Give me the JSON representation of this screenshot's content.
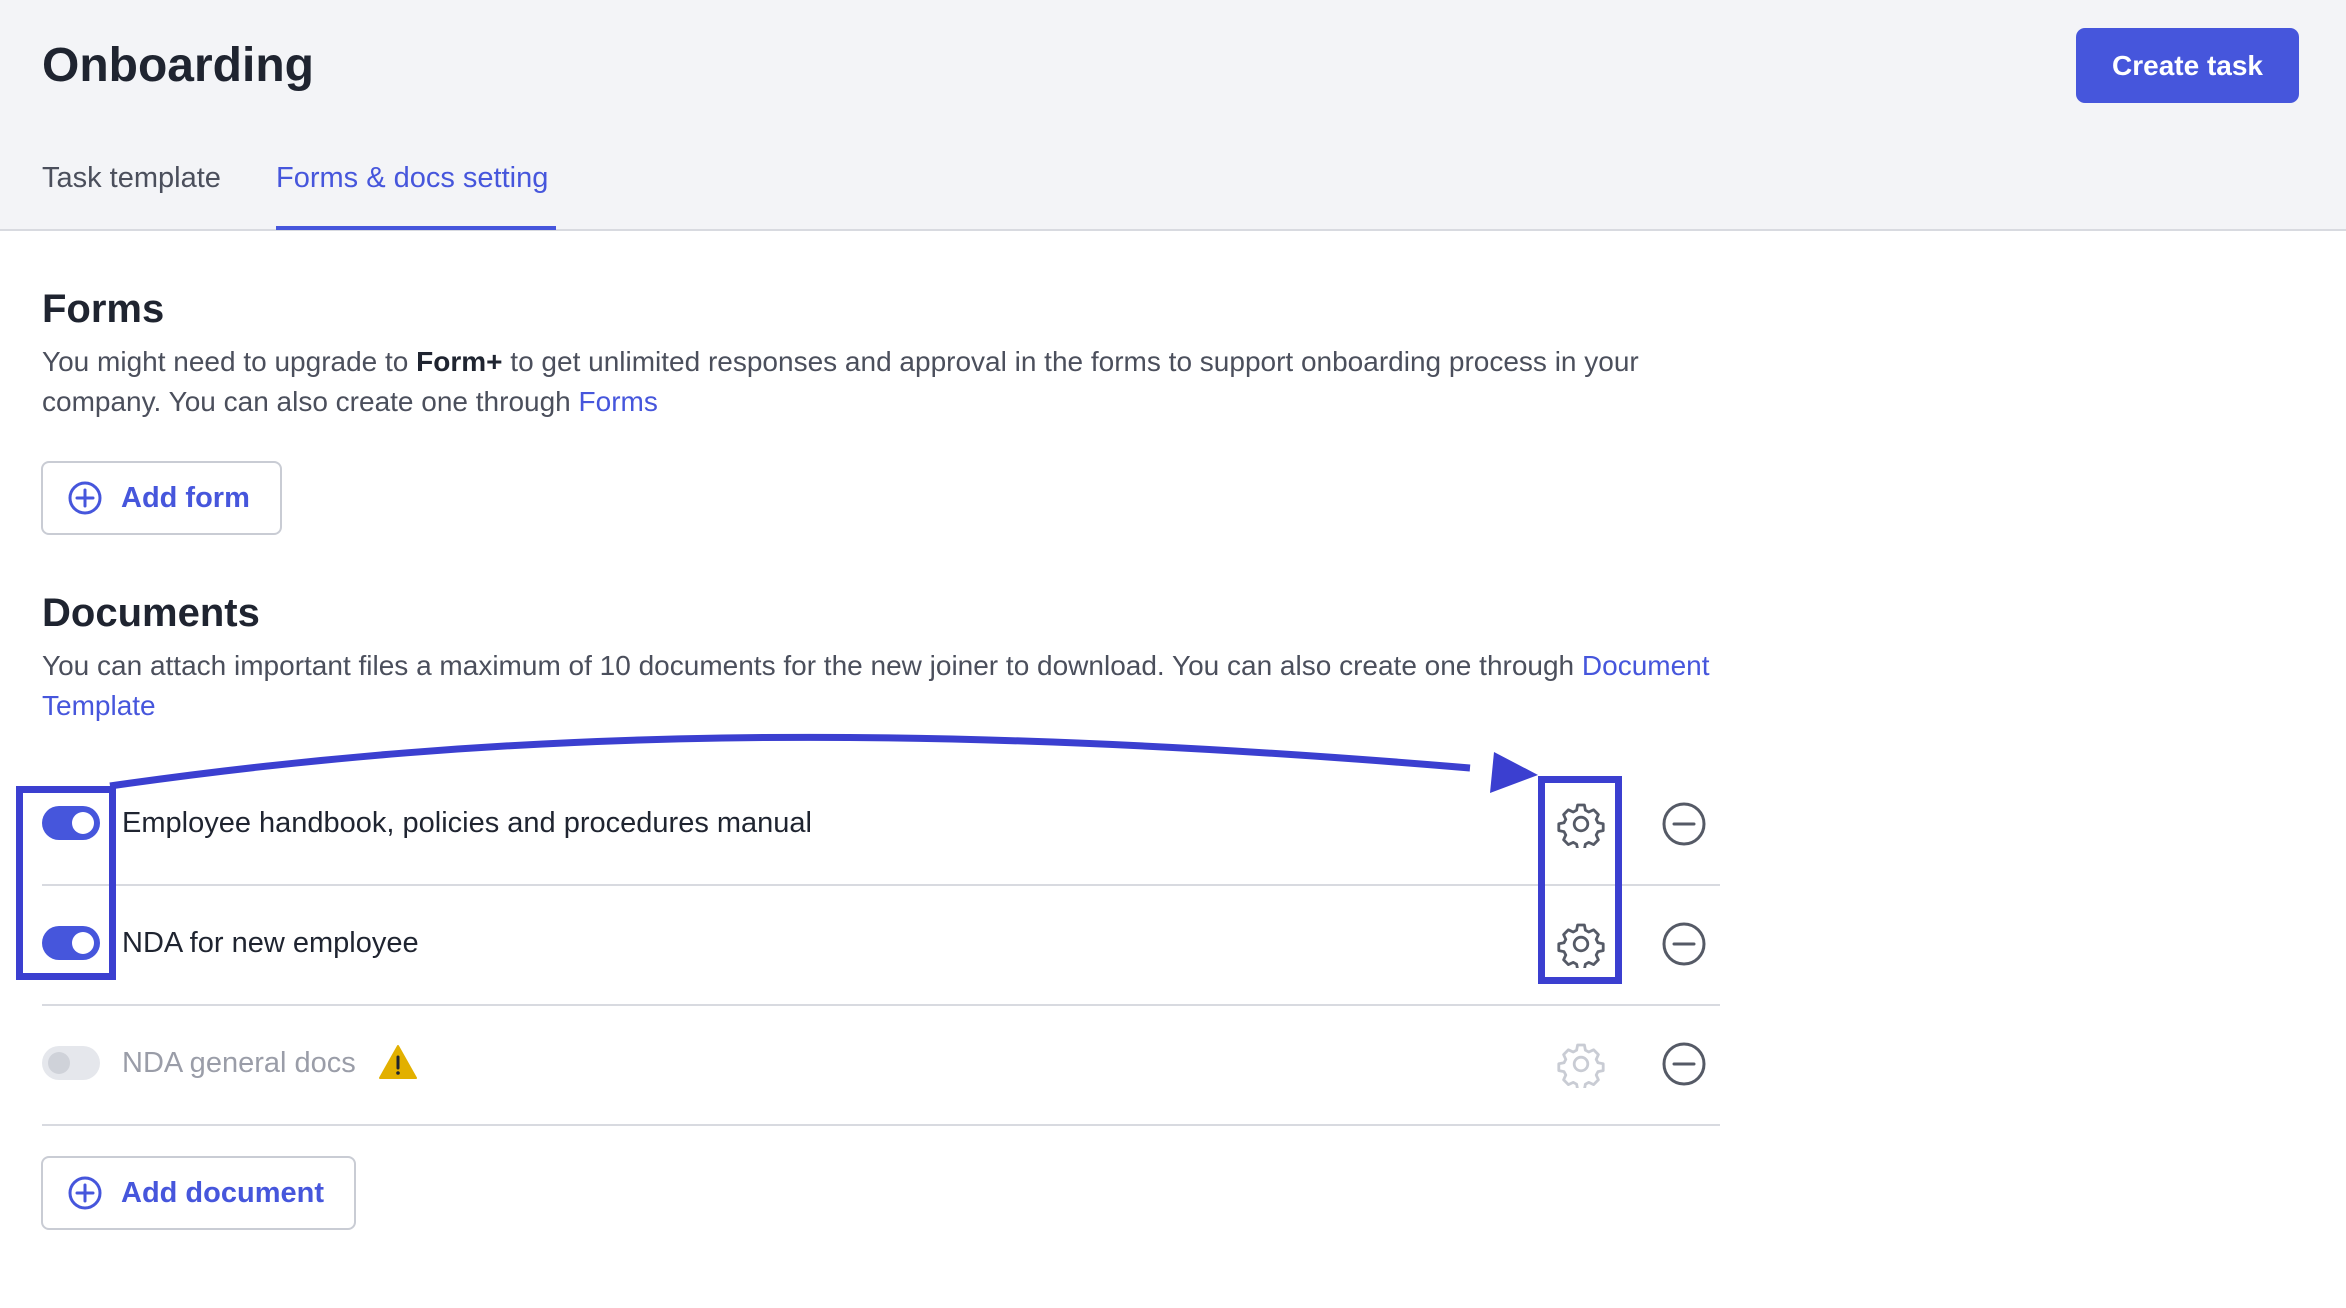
{
  "page": {
    "title": "Onboarding",
    "create_label": "Create task"
  },
  "tabs": [
    {
      "label": "Task template",
      "active": false
    },
    {
      "label": "Forms & docs setting",
      "active": true
    }
  ],
  "forms": {
    "title": "Forms",
    "desc_1": "You might need to upgrade to ",
    "desc_bold": "Form+",
    "desc_2": " to get unlimited responses and approval in the forms to support onboarding process in your company. You can also create one through ",
    "desc_link": "Forms",
    "add_label": "Add form"
  },
  "documents": {
    "title": "Documents",
    "desc": "You can attach important files a maximum of 10 documents for the new joiner to download. You can also create one through ",
    "desc_link": "Document Template",
    "add_label": "Add document",
    "items": [
      {
        "label": "Employee handbook, policies and procedures manual",
        "enabled": true
      },
      {
        "label": "NDA for new employee",
        "enabled": true
      },
      {
        "label": "NDA general docs",
        "enabled": false,
        "warning": true
      }
    ]
  },
  "colors": {
    "accent": "#4656dc",
    "annotation": "#3b3fd0",
    "warning": "#e2b000"
  },
  "icons": {
    "add": "plus-circle-icon",
    "settings": "gear-icon",
    "remove": "minus-circle-icon",
    "warning": "warning-icon"
  }
}
